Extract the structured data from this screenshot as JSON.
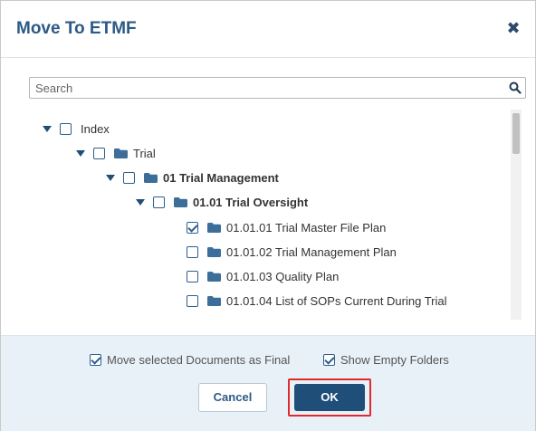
{
  "dialog": {
    "title": "Move To ETMF",
    "close_icon": "close-icon"
  },
  "search": {
    "placeholder": "Search",
    "value": "",
    "icon": "search-icon"
  },
  "tree": [
    {
      "label": "Index",
      "checked": false,
      "expanded": true,
      "bold": false,
      "folder": false
    },
    {
      "label": "Trial",
      "checked": false,
      "expanded": true,
      "bold": false,
      "folder": true
    },
    {
      "label": "01 Trial Management",
      "checked": false,
      "expanded": true,
      "bold": true,
      "folder": true
    },
    {
      "label": "01.01 Trial Oversight",
      "checked": false,
      "expanded": true,
      "bold": true,
      "folder": true
    },
    {
      "label": "01.01.01 Trial Master File Plan",
      "checked": true,
      "expanded": false,
      "bold": false,
      "folder": true
    },
    {
      "label": "01.01.02 Trial Management Plan",
      "checked": false,
      "expanded": false,
      "bold": false,
      "folder": true
    },
    {
      "label": "01.01.03 Quality Plan",
      "checked": false,
      "expanded": false,
      "bold": false,
      "folder": true
    },
    {
      "label": "01.01.04 List of SOPs Current During Trial",
      "checked": false,
      "expanded": false,
      "bold": false,
      "folder": true
    }
  ],
  "options": {
    "move_final_label": "Move selected Documents as Final",
    "move_final_checked": true,
    "show_empty_label": "Show Empty Folders",
    "show_empty_checked": true
  },
  "buttons": {
    "cancel": "Cancel",
    "ok": "OK"
  },
  "colors": {
    "title": "#2c5a85",
    "primary": "#1f4e79",
    "highlight": "#e02a2a",
    "footer_bg": "#e9f1f8",
    "folder": "#3d6e99"
  }
}
